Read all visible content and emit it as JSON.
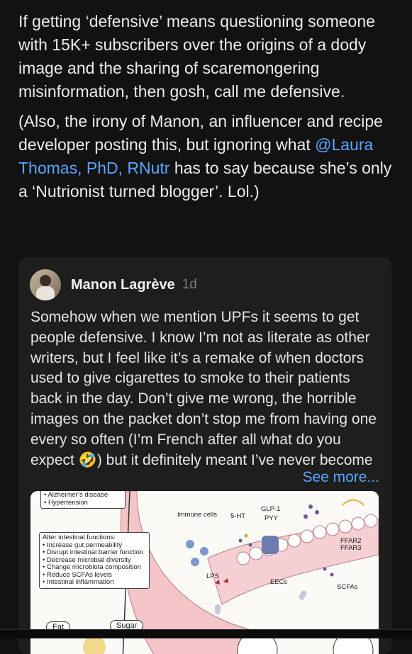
{
  "post": {
    "paragraph1": "If getting ‘defensive’ means questioning someone with 15K+ subscribers over the origins of a dody image and the sharing of scaremongering misinformation, then gosh, call me defensive.",
    "paragraph2_before": "(Also, the irony of Manon, an influencer and recipe developer posting this, but ignoring what ",
    "paragraph2_mention": "@Laura Thomas, PhD, RNutr",
    "paragraph2_after": " has to say because she’s only a ‘Nutrionist turned blogger’. Lol.)"
  },
  "quote": {
    "author": "Manon Lagrève",
    "time": "1d",
    "text": "Somehow when we mention UPFs it seems to get people defensive. I know I’m not as literate as other writers, but I feel like it’s a remake of when doctors used to give cigarettes to smoke to their patients back in the day. Don’t give me wrong, the horrible images on the packet don’t stop me from having one every so often (I’m French after all what do you expect 🤣) but it definitely meant I’ve never become",
    "see_more": "See more..."
  },
  "figure": {
    "top_box": [
      "• Alzheimer’s disease",
      "• Hypertension"
    ],
    "functions_title": "Alter intestinal functions:",
    "functions": [
      "• Increase gut permeability",
      "• Disrupt intestinal barrier function",
      "• Decrease microbial diversity",
      "• Change microbiota composition",
      "• Reduce SCFAs levels",
      "• Intestinal inflammation"
    ],
    "immune_cells": "Immune cells",
    "ht5": "5-HT",
    "glp1": "GLP-1",
    "pyy": "PYY",
    "lps": "LPS",
    "eecs": "EECs",
    "ffar2": "FFAR2",
    "ffar3": "FFAR3",
    "scfas": "SCFAs",
    "fat": "Fat",
    "sugar": "Sugar"
  }
}
